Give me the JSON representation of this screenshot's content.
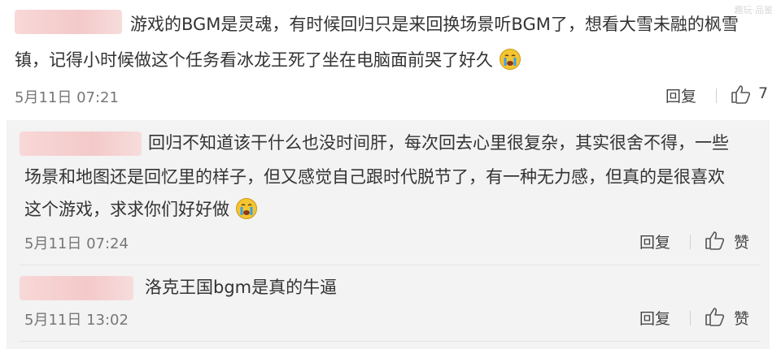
{
  "watermark": "趣玩·品鉴",
  "comments": [
    {
      "text_line1": "游戏的BGM是灵魂，有时候回归只是来回换场景听BGM了，想看大雪未融的枫雪",
      "text_line2": "镇，记得小时候做这个任务看冰龙王死了坐在电脑面前哭了好久",
      "time": "5月11日 07:21",
      "reply": "回复",
      "likes": "7"
    }
  ],
  "replies": [
    {
      "text_line1": "回归不知道该干什么也没时间肝，每次回去心里很复杂，其实很舍不得，一些",
      "text_line2": "场景和地图还是回忆里的样子，但又感觉自己跟时代脱节了，有一种无力感，但真的是很喜欢",
      "text_line3": "这个游戏，求求你们好好做",
      "time": "5月11日 07:24",
      "reply": "回复",
      "like": "赞"
    },
    {
      "text_line1": "洛克王国bgm是真的牛逼",
      "time": "5月11日 13:02",
      "reply": "回复",
      "like": "赞"
    }
  ],
  "icons": {
    "emoji": "crying-emoji",
    "like": "thumbs-up-icon"
  }
}
